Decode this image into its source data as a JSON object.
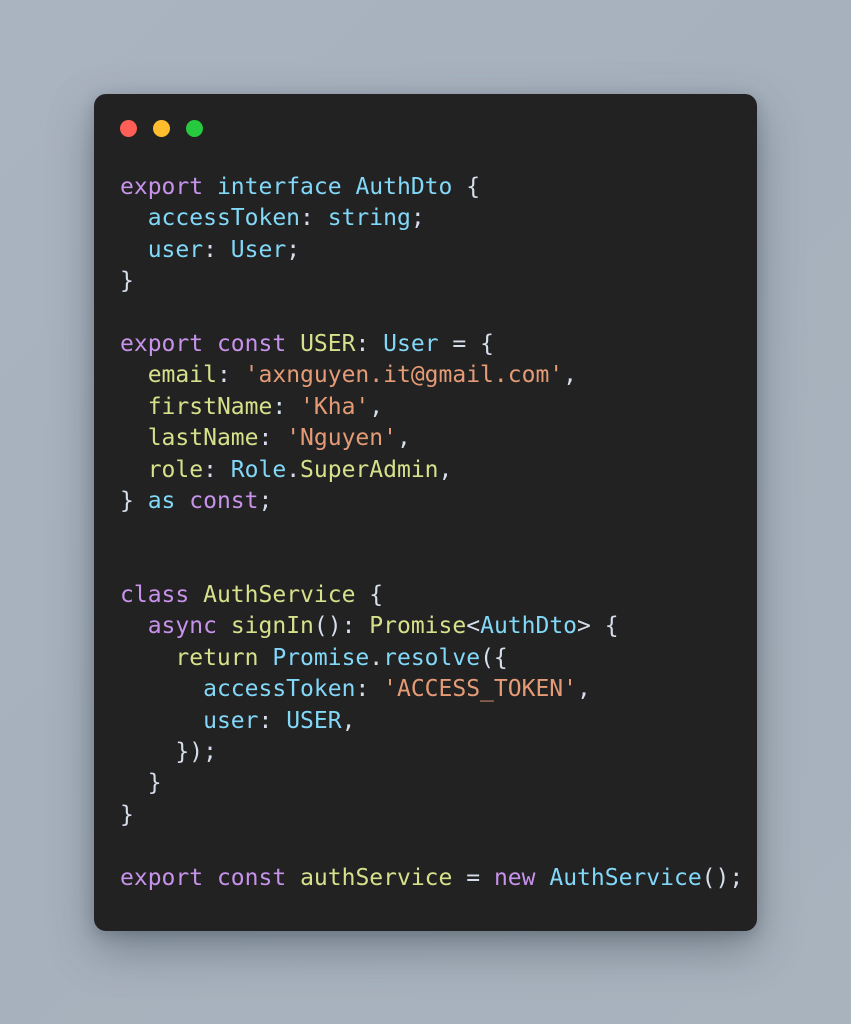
{
  "window": {
    "traffic_lights": [
      {
        "name": "close-button",
        "color": "#ff5f56"
      },
      {
        "name": "minimize-button",
        "color": "#ffbd2e"
      },
      {
        "name": "maximize-button",
        "color": "#27c93f"
      }
    ],
    "background_color": "#a8b2be",
    "card_color": "#222222"
  },
  "theme": {
    "keyword": "#c792ea",
    "type": "#82d8f8",
    "function": "#d7e08a",
    "string": "#e59b76",
    "plain": "#d6deeb"
  },
  "code": {
    "language": "typescript",
    "plain_text": "export interface AuthDto {\n  accessToken: string;\n  user: User;\n}\n\nexport const USER: User = {\n  email: 'axnguyen.it@gmail.com',\n  firstName: 'Kha',\n  lastName: 'Nguyen',\n  role: Role.SuperAdmin,\n} as const;\n\n\nclass AuthService {\n  async signIn(): Promise<AuthDto> {\n    return Promise.resolve({\n      accessToken: 'ACCESS_TOKEN',\n      user: USER,\n    });\n  }\n}\n\nexport const authService = new AuthService();",
    "lines": [
      {
        "id": "line-1",
        "tokens": [
          {
            "t": "export",
            "c": "kw"
          },
          {
            "t": " ",
            "c": "pl"
          },
          {
            "t": "interface",
            "c": "type"
          },
          {
            "t": " ",
            "c": "pl"
          },
          {
            "t": "AuthDto",
            "c": "type"
          },
          {
            "t": " {",
            "c": "pl"
          }
        ]
      },
      {
        "id": "line-2",
        "tokens": [
          {
            "t": "  ",
            "c": "pl"
          },
          {
            "t": "accessToken",
            "c": "type"
          },
          {
            "t": ": ",
            "c": "pl"
          },
          {
            "t": "string",
            "c": "type"
          },
          {
            "t": ";",
            "c": "pl"
          }
        ]
      },
      {
        "id": "line-3",
        "tokens": [
          {
            "t": "  ",
            "c": "pl"
          },
          {
            "t": "user",
            "c": "type"
          },
          {
            "t": ": ",
            "c": "pl"
          },
          {
            "t": "User",
            "c": "type"
          },
          {
            "t": ";",
            "c": "pl"
          }
        ]
      },
      {
        "id": "line-4",
        "tokens": [
          {
            "t": "}",
            "c": "pl"
          }
        ]
      },
      {
        "id": "line-5",
        "tokens": []
      },
      {
        "id": "line-6",
        "tokens": [
          {
            "t": "export",
            "c": "kw"
          },
          {
            "t": " ",
            "c": "pl"
          },
          {
            "t": "const",
            "c": "kw"
          },
          {
            "t": " ",
            "c": "pl"
          },
          {
            "t": "USER",
            "c": "fn"
          },
          {
            "t": ": ",
            "c": "pl"
          },
          {
            "t": "User",
            "c": "type"
          },
          {
            "t": " = {",
            "c": "pl"
          }
        ]
      },
      {
        "id": "line-7",
        "tokens": [
          {
            "t": "  ",
            "c": "pl"
          },
          {
            "t": "email",
            "c": "fn"
          },
          {
            "t": ": ",
            "c": "pl"
          },
          {
            "t": "'axnguyen.it@gmail.com'",
            "c": "str"
          },
          {
            "t": ",",
            "c": "pl"
          }
        ]
      },
      {
        "id": "line-8",
        "tokens": [
          {
            "t": "  ",
            "c": "pl"
          },
          {
            "t": "firstName",
            "c": "fn"
          },
          {
            "t": ": ",
            "c": "pl"
          },
          {
            "t": "'Kha'",
            "c": "str"
          },
          {
            "t": ",",
            "c": "pl"
          }
        ]
      },
      {
        "id": "line-9",
        "tokens": [
          {
            "t": "  ",
            "c": "pl"
          },
          {
            "t": "lastName",
            "c": "fn"
          },
          {
            "t": ": ",
            "c": "pl"
          },
          {
            "t": "'Nguyen'",
            "c": "str"
          },
          {
            "t": ",",
            "c": "pl"
          }
        ]
      },
      {
        "id": "line-10",
        "tokens": [
          {
            "t": "  ",
            "c": "pl"
          },
          {
            "t": "role",
            "c": "fn"
          },
          {
            "t": ": ",
            "c": "pl"
          },
          {
            "t": "Role",
            "c": "type"
          },
          {
            "t": ".",
            "c": "pl"
          },
          {
            "t": "SuperAdmin",
            "c": "fn"
          },
          {
            "t": ",",
            "c": "pl"
          }
        ]
      },
      {
        "id": "line-11",
        "tokens": [
          {
            "t": "} ",
            "c": "pl"
          },
          {
            "t": "as",
            "c": "type"
          },
          {
            "t": " ",
            "c": "pl"
          },
          {
            "t": "const",
            "c": "kw"
          },
          {
            "t": ";",
            "c": "pl"
          }
        ]
      },
      {
        "id": "line-12",
        "tokens": []
      },
      {
        "id": "line-13",
        "tokens": []
      },
      {
        "id": "line-14",
        "tokens": [
          {
            "t": "class",
            "c": "kw"
          },
          {
            "t": " ",
            "c": "pl"
          },
          {
            "t": "AuthService",
            "c": "fn"
          },
          {
            "t": " {",
            "c": "pl"
          }
        ]
      },
      {
        "id": "line-15",
        "tokens": [
          {
            "t": "  ",
            "c": "pl"
          },
          {
            "t": "async",
            "c": "kw"
          },
          {
            "t": " ",
            "c": "pl"
          },
          {
            "t": "signIn",
            "c": "fn"
          },
          {
            "t": "(): ",
            "c": "pl"
          },
          {
            "t": "Promise",
            "c": "fn"
          },
          {
            "t": "<",
            "c": "pl"
          },
          {
            "t": "AuthDto",
            "c": "type"
          },
          {
            "t": "> {",
            "c": "pl"
          }
        ]
      },
      {
        "id": "line-16",
        "tokens": [
          {
            "t": "    ",
            "c": "pl"
          },
          {
            "t": "return",
            "c": "fn"
          },
          {
            "t": " ",
            "c": "pl"
          },
          {
            "t": "Promise",
            "c": "type"
          },
          {
            "t": ".",
            "c": "pl"
          },
          {
            "t": "resolve",
            "c": "type"
          },
          {
            "t": "({",
            "c": "pl"
          }
        ]
      },
      {
        "id": "line-17",
        "tokens": [
          {
            "t": "      ",
            "c": "pl"
          },
          {
            "t": "accessToken",
            "c": "type"
          },
          {
            "t": ": ",
            "c": "pl"
          },
          {
            "t": "'ACCESS_TOKEN'",
            "c": "str"
          },
          {
            "t": ",",
            "c": "pl"
          }
        ]
      },
      {
        "id": "line-18",
        "tokens": [
          {
            "t": "      ",
            "c": "pl"
          },
          {
            "t": "user",
            "c": "type"
          },
          {
            "t": ": ",
            "c": "pl"
          },
          {
            "t": "USER",
            "c": "type"
          },
          {
            "t": ",",
            "c": "pl"
          }
        ]
      },
      {
        "id": "line-19",
        "tokens": [
          {
            "t": "    });",
            "c": "pl"
          }
        ]
      },
      {
        "id": "line-20",
        "tokens": [
          {
            "t": "  }",
            "c": "pl"
          }
        ]
      },
      {
        "id": "line-21",
        "tokens": [
          {
            "t": "}",
            "c": "pl"
          }
        ]
      },
      {
        "id": "line-22",
        "tokens": []
      },
      {
        "id": "line-23",
        "tokens": [
          {
            "t": "export",
            "c": "kw"
          },
          {
            "t": " ",
            "c": "pl"
          },
          {
            "t": "const",
            "c": "kw"
          },
          {
            "t": " ",
            "c": "pl"
          },
          {
            "t": "authService",
            "c": "fn"
          },
          {
            "t": " = ",
            "c": "pl"
          },
          {
            "t": "new",
            "c": "kw"
          },
          {
            "t": " ",
            "c": "pl"
          },
          {
            "t": "AuthService",
            "c": "type"
          },
          {
            "t": "();",
            "c": "pl"
          }
        ]
      }
    ]
  }
}
